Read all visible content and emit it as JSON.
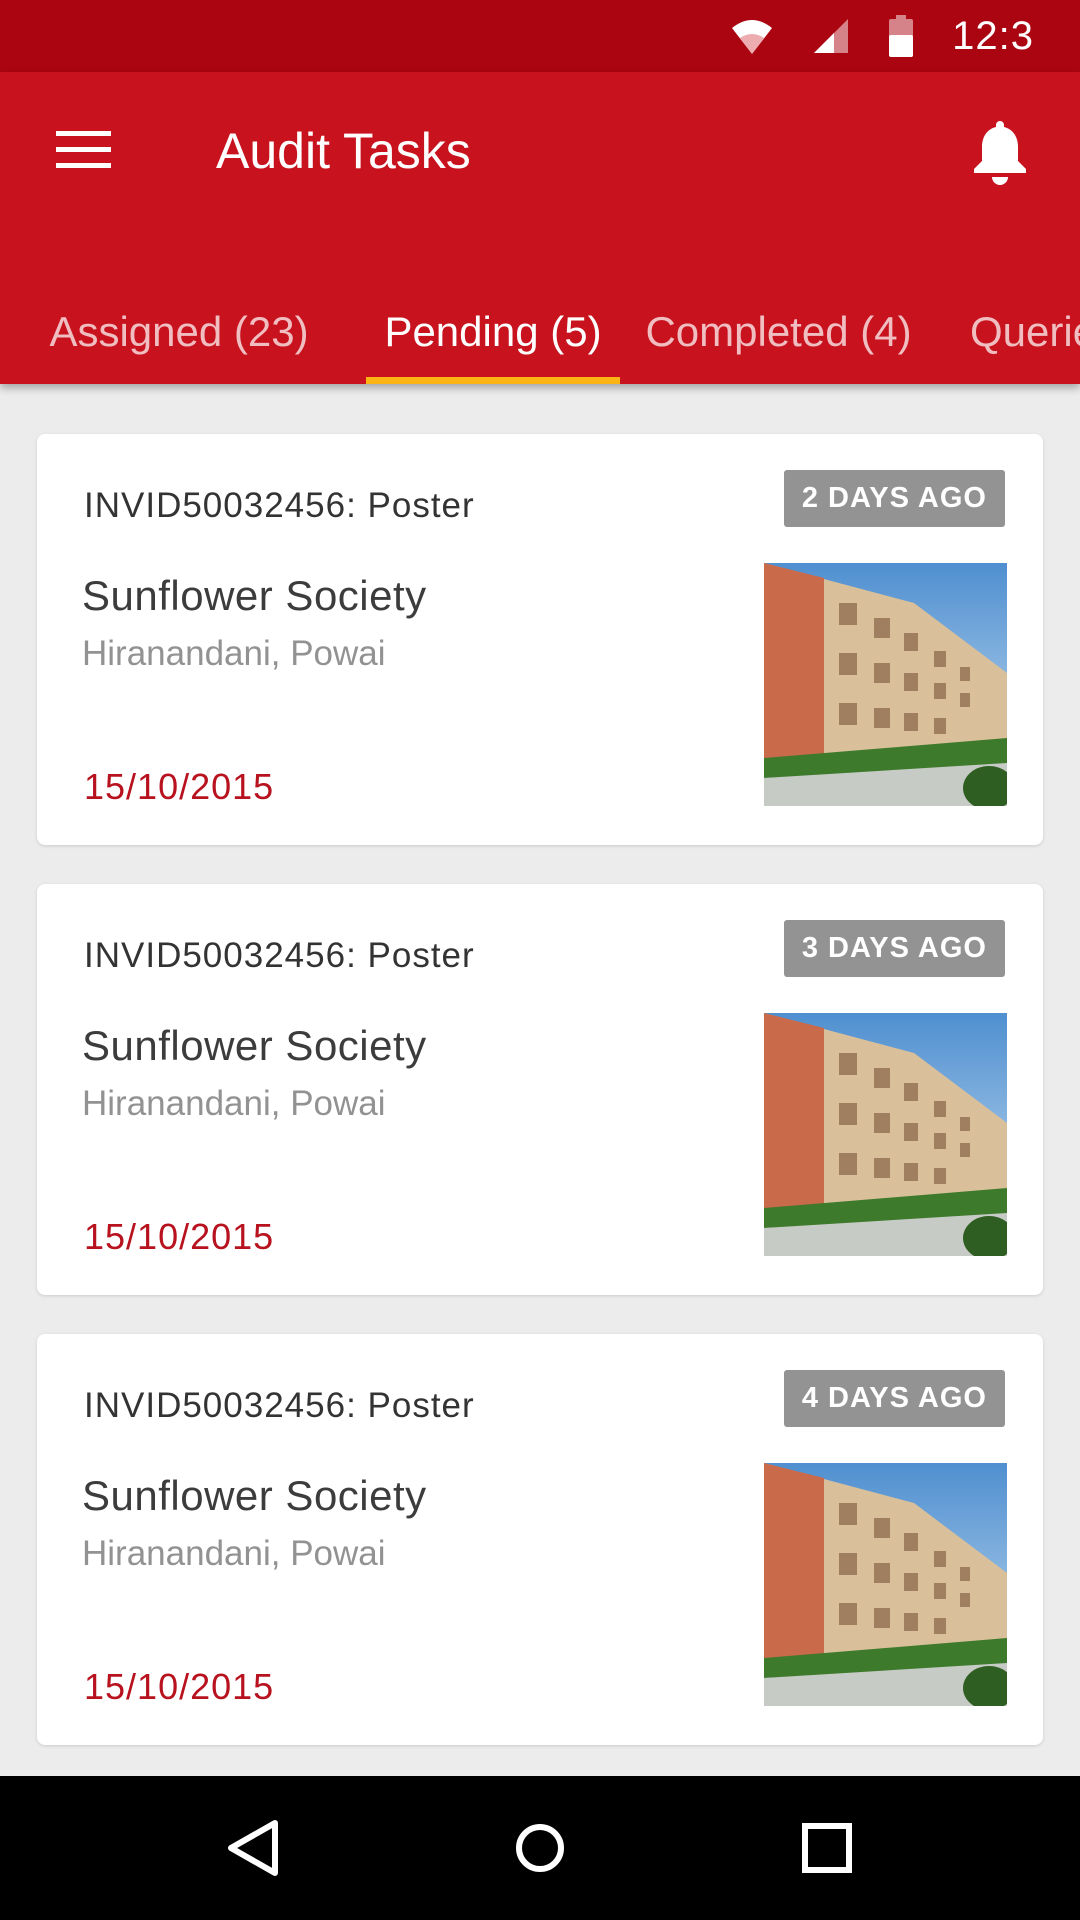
{
  "status_bar": {
    "time": "12:3"
  },
  "app_bar": {
    "title": "Audit Tasks",
    "menu_icon": "menu-icon",
    "notification_icon": "bell-icon"
  },
  "tabs": [
    {
      "label": "Assigned (23)",
      "active": false
    },
    {
      "label": "Pending (5)",
      "active": true
    },
    {
      "label": "Completed (4)",
      "active": false
    },
    {
      "label": "Queries",
      "active": false
    }
  ],
  "tasks": [
    {
      "code": "INVID50032456:  Poster",
      "age": "2 DAYS AGO",
      "name": "Sunflower Society",
      "location": "Hiranandani, Powai",
      "date": "15/10/2015"
    },
    {
      "code": "INVID50032456:  Poster",
      "age": "3 DAYS AGO",
      "name": "Sunflower Society",
      "location": "Hiranandani, Powai",
      "date": "15/10/2015"
    },
    {
      "code": "INVID50032456:  Poster",
      "age": "4 DAYS AGO",
      "name": "Sunflower Society",
      "location": "Hiranandani, Powai",
      "date": "15/10/2015"
    }
  ],
  "nav_bar": {
    "back": "back-icon",
    "home": "home-icon",
    "recents": "recents-icon"
  },
  "colors": {
    "primary": "#c8121e",
    "status_bar": "#ab0511",
    "tab_indicator": "#fcb316",
    "badge": "#939393",
    "date": "#b7121e"
  }
}
